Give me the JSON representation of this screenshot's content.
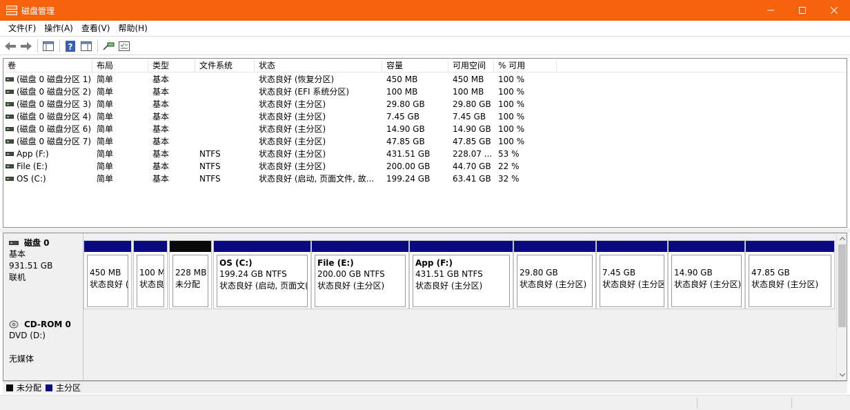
{
  "window": {
    "title": "磁盘管理"
  },
  "menu": [
    "文件(F)",
    "操作(A)",
    "查看(V)",
    "帮助(H)"
  ],
  "toolbar": [
    "back-icon",
    "forward-icon",
    "console-tree-icon",
    "help-icon",
    "properties-icon",
    "rescan-icon",
    "checklist-icon"
  ],
  "volumes": {
    "columns": [
      "卷",
      "布局",
      "类型",
      "文件系统",
      "状态",
      "容量",
      "可用空间",
      "% 可用"
    ],
    "rows": [
      [
        "(磁盘 0 磁盘分区 1)",
        "简单",
        "基本",
        "",
        "状态良好 (恢复分区)",
        "450 MB",
        "450 MB",
        "100 %"
      ],
      [
        "(磁盘 0 磁盘分区 2)",
        "简单",
        "基本",
        "",
        "状态良好 (EFI 系统分区)",
        "100 MB",
        "100 MB",
        "100 %"
      ],
      [
        "(磁盘 0 磁盘分区 3)",
        "简单",
        "基本",
        "",
        "状态良好 (主分区)",
        "29.80 GB",
        "29.80 GB",
        "100 %"
      ],
      [
        "(磁盘 0 磁盘分区 4)",
        "简单",
        "基本",
        "",
        "状态良好 (主分区)",
        "7.45 GB",
        "7.45 GB",
        "100 %"
      ],
      [
        "(磁盘 0 磁盘分区 6)",
        "简单",
        "基本",
        "",
        "状态良好 (主分区)",
        "14.90 GB",
        "14.90 GB",
        "100 %"
      ],
      [
        "(磁盘 0 磁盘分区 7)",
        "简单",
        "基本",
        "",
        "状态良好 (主分区)",
        "47.85 GB",
        "47.85 GB",
        "100 %"
      ],
      [
        "App (F:)",
        "简单",
        "基本",
        "NTFS",
        "状态良好 (主分区)",
        "431.51 GB",
        "228.07 ...",
        "53 %"
      ],
      [
        "File (E:)",
        "简单",
        "基本",
        "NTFS",
        "状态良好 (主分区)",
        "200.00 GB",
        "44.70 GB",
        "22 %"
      ],
      [
        "OS (C:)",
        "简单",
        "基本",
        "NTFS",
        "状态良好 (启动, 页面文件, 故...",
        "199.24 GB",
        "63.41 GB",
        "32 %"
      ]
    ]
  },
  "disk0": {
    "name": "磁盘 0",
    "type": "基本",
    "size": "931.51 GB",
    "status": "联机",
    "partitions": [
      {
        "title": "",
        "size": "450 MB",
        "status": "状态良好 (",
        "kind": "primary"
      },
      {
        "title": "",
        "size": "100 M",
        "status": "状态良",
        "kind": "primary"
      },
      {
        "title": "",
        "size": "228 MB",
        "status": "未分配",
        "kind": "unallocated"
      },
      {
        "title": "OS  (C:)",
        "size": "199.24 GB NTFS",
        "status": "状态良好 (启动, 页面文(",
        "kind": "primary"
      },
      {
        "title": "File  (E:)",
        "size": "200.00 GB NTFS",
        "status": "状态良好 (主分区)",
        "kind": "primary"
      },
      {
        "title": "App  (F:)",
        "size": "431.51 GB NTFS",
        "status": "状态良好 (主分区)",
        "kind": "primary"
      },
      {
        "title": "",
        "size": "29.80 GB",
        "status": "状态良好 (主分区)",
        "kind": "primary"
      },
      {
        "title": "",
        "size": "7.45 GB",
        "status": "状态良好 (主分区",
        "kind": "primary"
      },
      {
        "title": "",
        "size": "14.90 GB",
        "status": "状态良好 (主分区)",
        "kind": "primary"
      },
      {
        "title": "",
        "size": "47.85 GB",
        "status": "状态良好 (主分区)",
        "kind": "primary"
      }
    ]
  },
  "cdrom0": {
    "name": "CD-ROM 0",
    "drive": "DVD (D:)",
    "status": "无媒体"
  },
  "legend": [
    {
      "label": "未分配",
      "color": "#0a0a0a"
    },
    {
      "label": "主分区",
      "color": "#0a0a80"
    }
  ],
  "colors": {
    "titlebar": "#f7630c",
    "primary": "#0a0a80",
    "unallocated": "#0a0a0a"
  }
}
